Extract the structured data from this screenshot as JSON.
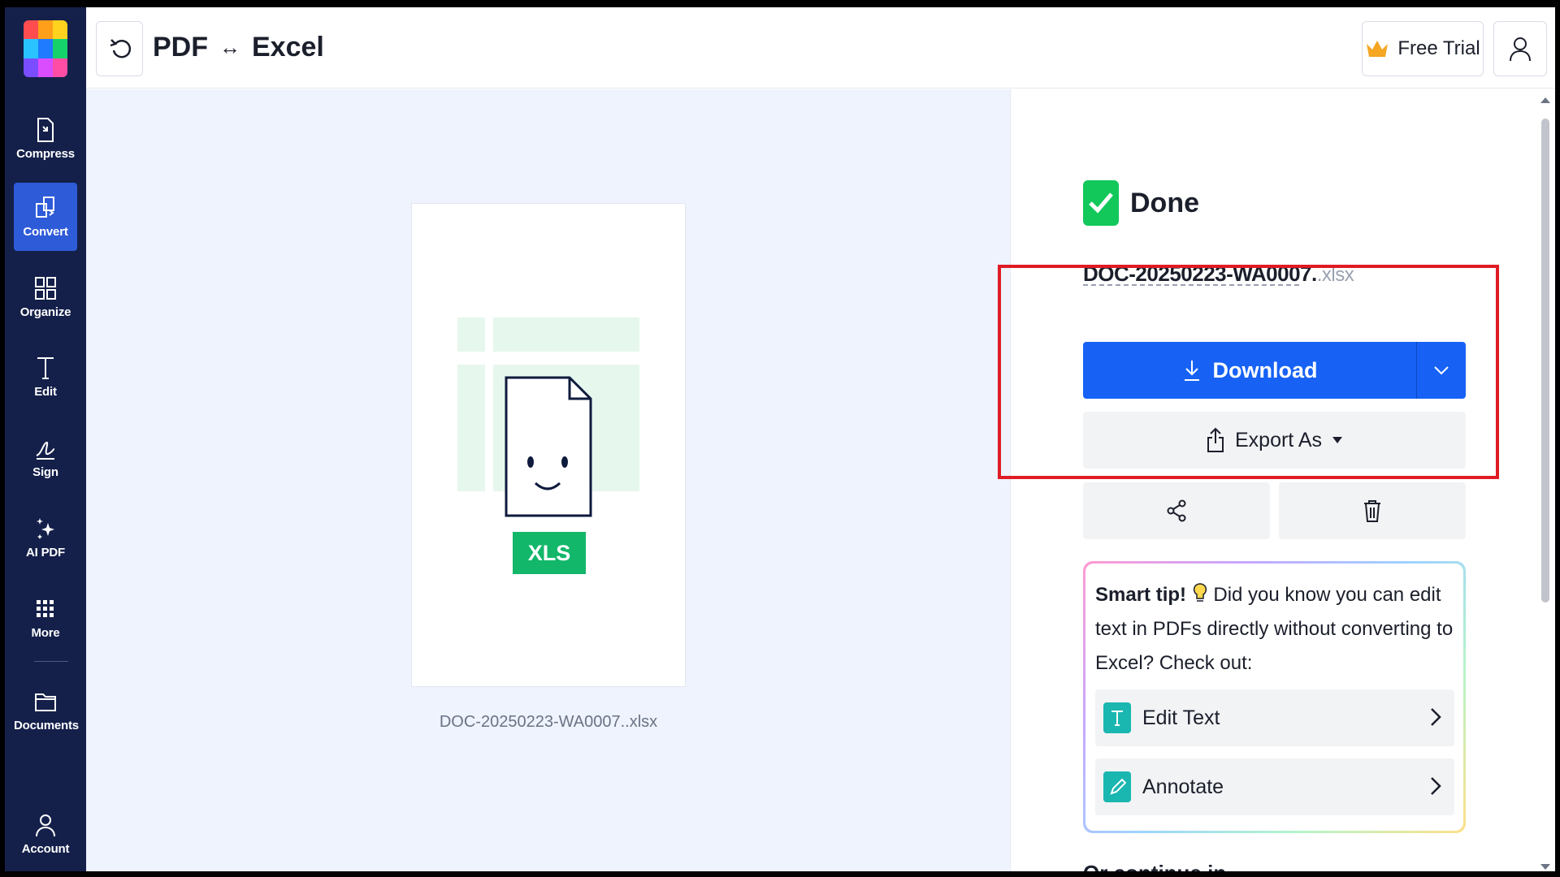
{
  "header": {
    "title_left": "PDF",
    "title_arrow": "↔",
    "title_right": "Excel",
    "free_trial": "Free Trial"
  },
  "sidebar": {
    "items": [
      {
        "label": "Compress",
        "icon": "compress-icon"
      },
      {
        "label": "Convert",
        "icon": "convert-icon",
        "active": true
      },
      {
        "label": "Organize",
        "icon": "organize-icon"
      },
      {
        "label": "Edit",
        "icon": "edit-icon"
      },
      {
        "label": "Sign",
        "icon": "sign-icon"
      },
      {
        "label": "AI PDF",
        "icon": "ai-sparkle-icon"
      },
      {
        "label": "More",
        "icon": "grid-icon"
      },
      {
        "label": "Documents",
        "icon": "folder-icon"
      },
      {
        "label": "Account",
        "icon": "user-icon"
      }
    ]
  },
  "preview": {
    "badge": "XLS",
    "file_name": "DOC-20250223-WA0007..xlsx"
  },
  "panel": {
    "status": "Done",
    "file_base": "DOC-20250223-WA0007.",
    "file_ext": ".xlsx",
    "download_label": "Download",
    "export_label": "Export As",
    "tip_title": "Smart tip!",
    "tip_body": "Did you know you can edit text in PDFs directly without converting to Excel? Check out:",
    "tip_items": [
      {
        "label": "Edit Text",
        "icon": "text-icon"
      },
      {
        "label": "Annotate",
        "icon": "pencil-icon"
      }
    ],
    "continue_label": "Or continue in"
  },
  "colors": {
    "sidebar_bg": "#14204a",
    "accent": "#1762f5",
    "success": "#12c85a",
    "highlight": "#e01b24"
  }
}
